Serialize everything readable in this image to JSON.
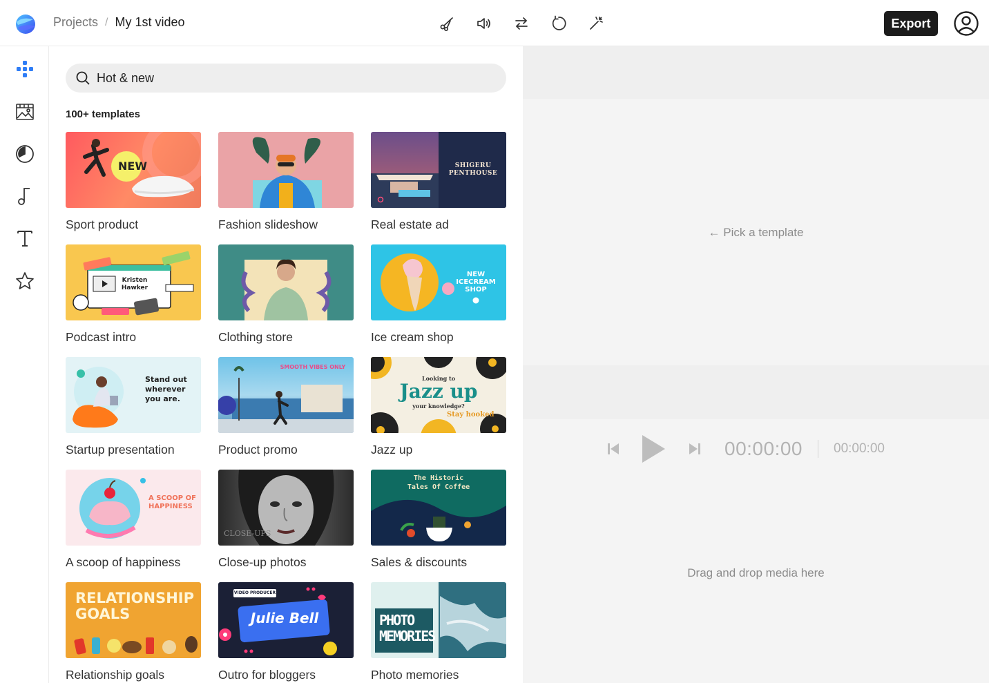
{
  "breadcrumb": {
    "parent": "Projects",
    "separator": "/",
    "current": "My 1st video"
  },
  "toolbar": {
    "tools": [
      "scissors-icon",
      "volume-icon",
      "swap-icon",
      "rotate-icon",
      "magic-wand-icon"
    ],
    "export_label": "Export"
  },
  "rail": [
    "templates-icon",
    "media-icon",
    "stickers-icon",
    "music-icon",
    "text-icon",
    "favorites-icon"
  ],
  "panel": {
    "search_placeholder": "Hot & new",
    "count_label": "100+ templates",
    "templates": [
      {
        "label": "Sport product"
      },
      {
        "label": "Fashion slideshow"
      },
      {
        "label": "Real estate ad"
      },
      {
        "label": "Podcast intro"
      },
      {
        "label": "Clothing store"
      },
      {
        "label": "Ice cream shop"
      },
      {
        "label": "Startup presentation"
      },
      {
        "label": "Product promo"
      },
      {
        "label": "Jazz up"
      },
      {
        "label": "A scoop of happiness"
      },
      {
        "label": "Close-up photos"
      },
      {
        "label": "Sales & discounts"
      },
      {
        "label": "Relationship goals"
      },
      {
        "label": "Outro for bloggers"
      },
      {
        "label": "Photo memories"
      }
    ],
    "thumb_text": {
      "sport": "NEW",
      "realestate": "SHIGERU PENTHOUSE",
      "podcast": "Kristen Hawker",
      "icecream": "NEW ICECREAM SHOP",
      "startup": "Stand out wherever you are.",
      "product": "SMOOTH VIBES ONLY",
      "jazz_small": "Looking to",
      "jazz_big": "Jazz up",
      "jazz_sub": "your knowledge?",
      "jazz_tag": "Stay hooked",
      "scoop": "A SCOOP OF HAPPINESS",
      "closeup": "CLOSE-UPS",
      "sales": "The Historic Tales Of Coffee",
      "relationship": "RELATIONSHIP GOALS",
      "outro_tag": "VIDEO PRODUCER",
      "outro_name": "Julie Bell",
      "photo": "PHOTO MEMORIES"
    }
  },
  "preview": {
    "pick_hint": "← Pick a template",
    "current_time": "00:00:00",
    "total_time": "00:00:00",
    "drop_hint": "Drag and drop media here"
  },
  "colors": {
    "accent": "#2f7df6",
    "export_bg": "#1c1c1c",
    "preview_bg": "#f4f4f4"
  }
}
